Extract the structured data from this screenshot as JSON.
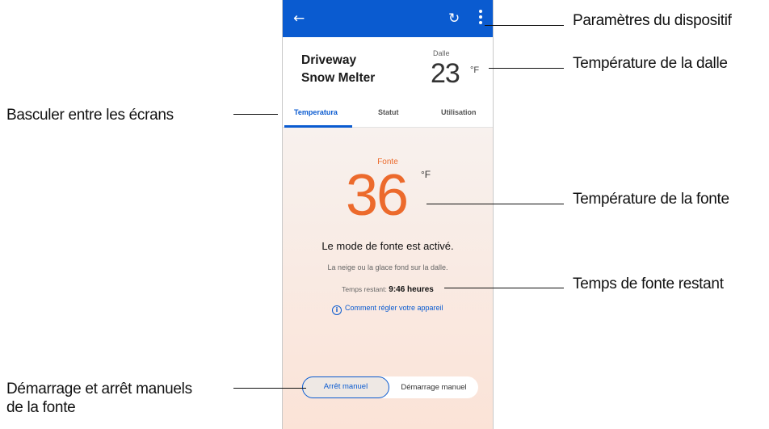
{
  "callouts": {
    "device_settings": "Paramètres du dispositif",
    "slab_temperature": "Température de la dalle",
    "switch_screens": "Basculer entre les écrans",
    "melt_temperature": "Température de la fonte",
    "melt_time_remaining": "Temps de fonte restant",
    "manual_start_stop_line1": "Démarrage et arrêt manuels",
    "manual_start_stop_line2": "de la fonte"
  },
  "appbar": {
    "back_icon": "←",
    "refresh_icon": "↻",
    "menu_icon": "more-vert"
  },
  "device": {
    "name_line1": "Driveway",
    "name_line2": "Snow Melter",
    "slab_label": "Dalle",
    "slab_temp": "23",
    "slab_unit": "°F"
  },
  "tabs": [
    {
      "label": "Temperatura",
      "active": true
    },
    {
      "label": "Statut",
      "active": false
    },
    {
      "label": "Utilisation",
      "active": false
    }
  ],
  "melt": {
    "label": "Fonte",
    "temp": "36",
    "unit": "°F"
  },
  "status": {
    "mode_title": "Le mode de fonte est activé.",
    "mode_description": "La neige ou la glace fond sur la dalle.",
    "remaining_label": "Temps restant:",
    "remaining_value": "9:46 heures",
    "help_link": "Comment régler votre appareil"
  },
  "manual": {
    "stop_label": "Arrêt manuel",
    "start_label": "Démarrage manuel",
    "selected": "stop"
  },
  "colors": {
    "primary": "#0a5bd0",
    "accent": "#ec6a2c"
  }
}
